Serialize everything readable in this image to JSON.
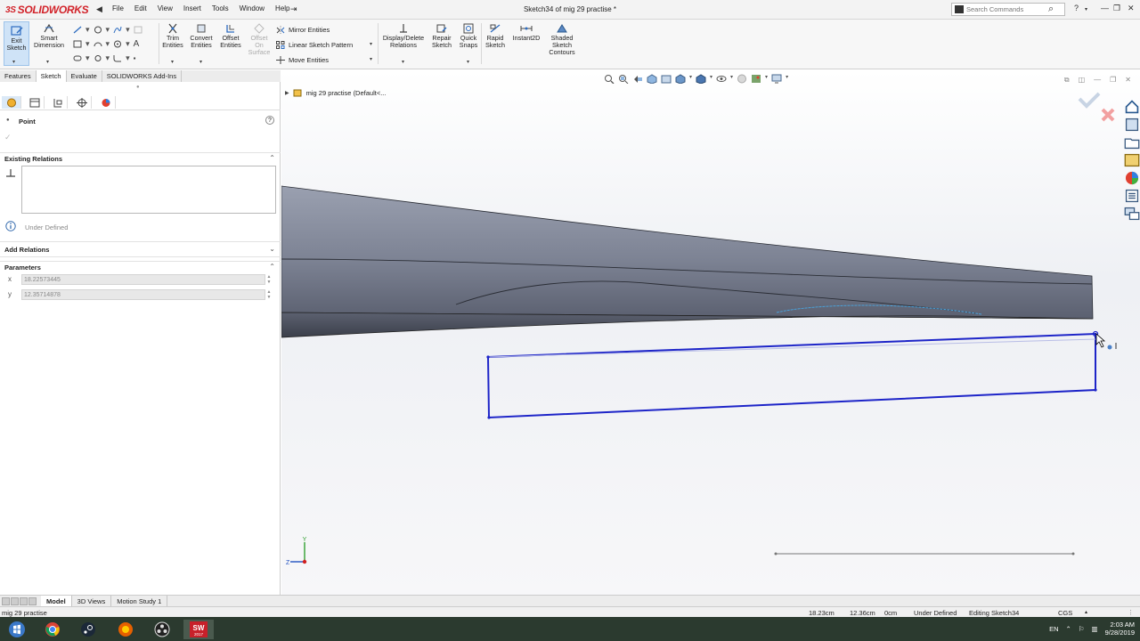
{
  "titlebar": {
    "logo_ds": "3S",
    "logo_text": "SOLIDWORKS",
    "menu": [
      "File",
      "Edit",
      "View",
      "Insert",
      "Tools",
      "Window",
      "Help"
    ],
    "doc_title": "Sketch34 of mig 29 practise *",
    "search_placeholder": "Search Commands",
    "help_label": "?"
  },
  "ribbon": {
    "exit_sketch": "Exit Sketch",
    "smart_dimension": "Smart Dimension",
    "trim_entities": "Trim Entities",
    "convert_entities": "Convert Entities",
    "offset_entities": "Offset Entities",
    "offset_on_surface": "Offset On Surface",
    "mirror_entities": "Mirror Entities",
    "linear_sketch_pattern": "Linear Sketch Pattern",
    "move_entities": "Move Entities",
    "display_delete_relations": "Display/Delete Relations",
    "repair_sketch": "Repair Sketch",
    "quick_snaps": "Quick Snaps",
    "rapid_sketch": "Rapid Sketch",
    "instant2d": "Instant2D",
    "shaded_sketch_contours": "Shaded Sketch Contours"
  },
  "cm_tabs": [
    "Features",
    "Sketch",
    "Evaluate",
    "SOLIDWORKS Add-Ins"
  ],
  "active_cm_tab": "Sketch",
  "panel": {
    "title": "Point",
    "help": "?",
    "existing_relations": "Existing Relations",
    "status": "Under Defined",
    "add_relations": "Add Relations",
    "parameters": "Parameters",
    "x_value": "18.22573445",
    "y_value": "12.35714878",
    "x_axis": "x",
    "y_axis": "y"
  },
  "viewport": {
    "tree_item": "mig 29 practise  (Default<...",
    "triad_z": "Z",
    "triad_y": "Y"
  },
  "bottom_tabs": [
    "Model",
    "3D Views",
    "Motion Study 1"
  ],
  "active_bottom_tab": "Model",
  "statusbar": {
    "doc": "mig 29 practise",
    "x": "18.23cm",
    "y": "12.36cm",
    "z": "0cm",
    "state": "Under Defined",
    "mode": "Editing Sketch34",
    "units": "CGS"
  },
  "taskbar": {
    "lang": "EN",
    "time": "2:03 AM",
    "date": "9/28/2019",
    "apps": [
      "windows-start",
      "chrome",
      "steam",
      "firefox",
      "obs",
      "solidworks"
    ],
    "sw_label": "SW",
    "sw_year": "2017"
  },
  "colors": {
    "brand_red": "#d2232a",
    "sketch_blue": "#1d24c8",
    "body_gray": "#7d8394"
  }
}
